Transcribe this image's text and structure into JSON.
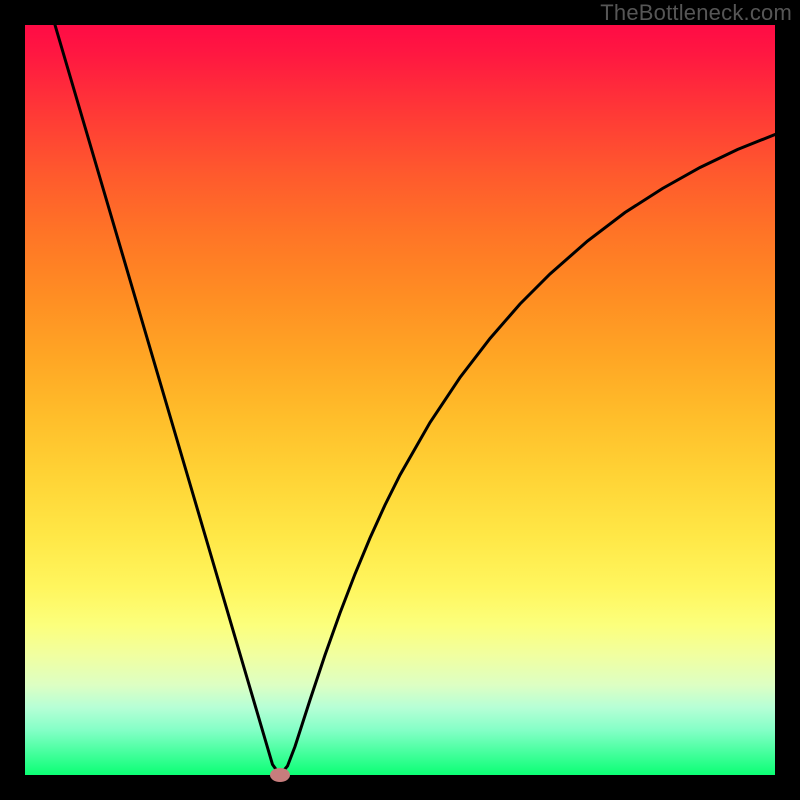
{
  "watermark": "TheBottleneck.com",
  "colors": {
    "black": "#000000",
    "marker": "#c77d7d",
    "curve": "#000000"
  },
  "chart_data": {
    "type": "line",
    "title": "",
    "xlabel": "",
    "ylabel": "",
    "xlim": [
      0,
      100
    ],
    "ylim": [
      0,
      100
    ],
    "grid": false,
    "legend": false,
    "series": [
      {
        "name": "bottleneck-curve",
        "x": [
          4,
          6,
          8,
          10,
          12,
          14,
          16,
          18,
          20,
          22,
          24,
          26,
          28,
          30,
          32,
          33,
          34,
          35,
          36,
          38,
          40,
          42,
          44,
          46,
          48,
          50,
          54,
          58,
          62,
          66,
          70,
          75,
          80,
          85,
          90,
          95,
          100
        ],
        "y": [
          100,
          93.2,
          86.4,
          79.6,
          72.8,
          66.0,
          59.2,
          52.4,
          45.6,
          38.8,
          32.0,
          25.2,
          18.4,
          11.6,
          4.8,
          1.4,
          0.0,
          1.2,
          3.8,
          10.0,
          16.0,
          21.6,
          26.8,
          31.6,
          36.0,
          40.0,
          47.0,
          53.0,
          58.2,
          62.8,
          66.8,
          71.2,
          75.0,
          78.2,
          81.0,
          83.4,
          85.4
        ]
      }
    ],
    "marker": {
      "x": 34,
      "y": 0
    },
    "background_gradient": {
      "top": "#ff0b45",
      "bottom": "#0bff74",
      "description": "vertical red-orange-yellow-green gradient"
    }
  }
}
